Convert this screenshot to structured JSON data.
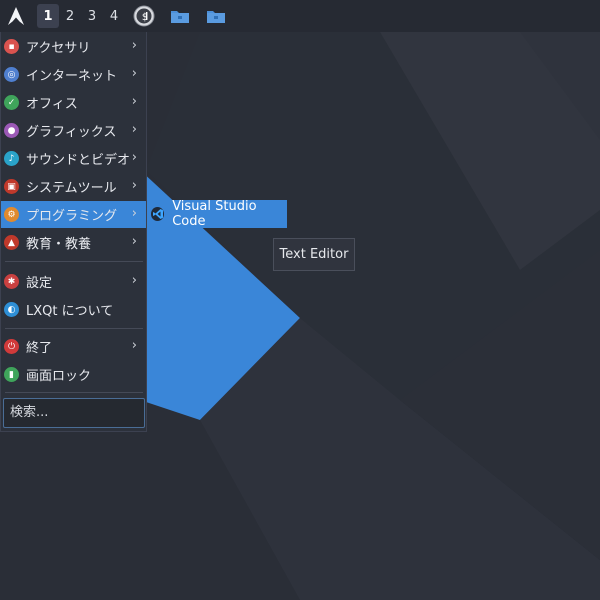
{
  "panel": {
    "menu_icon": "arch-logo-icon",
    "workspaces": [
      "1",
      "2",
      "3",
      "4"
    ],
    "active_workspace": "1",
    "terminal_label": "$",
    "folder_icon": "folder-icon"
  },
  "menu": {
    "items": [
      {
        "label": "アクセサリ",
        "icon": "accessories-icon",
        "color": "#d9534f",
        "submenu": true
      },
      {
        "label": "インターネット",
        "icon": "internet-icon",
        "color": "#4f7fcf",
        "submenu": true
      },
      {
        "label": "オフィス",
        "icon": "office-icon",
        "color": "#3fa45b",
        "submenu": true
      },
      {
        "label": "グラフィックス",
        "icon": "graphics-icon",
        "color": "#9b59b6",
        "submenu": true
      },
      {
        "label": "サウンドとビデオ",
        "icon": "multimedia-icon",
        "color": "#2aa3c9",
        "submenu": true
      },
      {
        "label": "システムツール",
        "icon": "system-tools-icon",
        "color": "#c0392b",
        "submenu": true
      },
      {
        "label": "プログラミング",
        "icon": "programming-icon",
        "color": "#e08a2e",
        "submenu": true
      },
      {
        "label": "教育・教養",
        "icon": "education-icon",
        "color": "#c0392b",
        "submenu": true
      },
      {
        "label": "設定",
        "icon": "settings-icon",
        "color": "#c94040",
        "submenu": true
      },
      {
        "label": "LXQt について",
        "icon": "lxqt-about-icon",
        "color": "#2e8fd6",
        "submenu": false
      },
      {
        "label": "終了",
        "icon": "power-icon",
        "color": "#d03a3a",
        "submenu": true
      },
      {
        "label": "画面ロック",
        "icon": "lock-icon",
        "color": "#3fa45b",
        "submenu": false
      }
    ],
    "highlighted": "プログラミング",
    "arrow": "›",
    "search_placeholder": "検索..."
  },
  "submenu": {
    "item_label": "Visual Studio Code",
    "item_icon": "vscode-icon"
  },
  "tooltip": {
    "text": "Text Editor"
  },
  "colors": {
    "accent": "#3a86d8",
    "panel": "#262a33",
    "menu_bg": "#2c313b"
  }
}
